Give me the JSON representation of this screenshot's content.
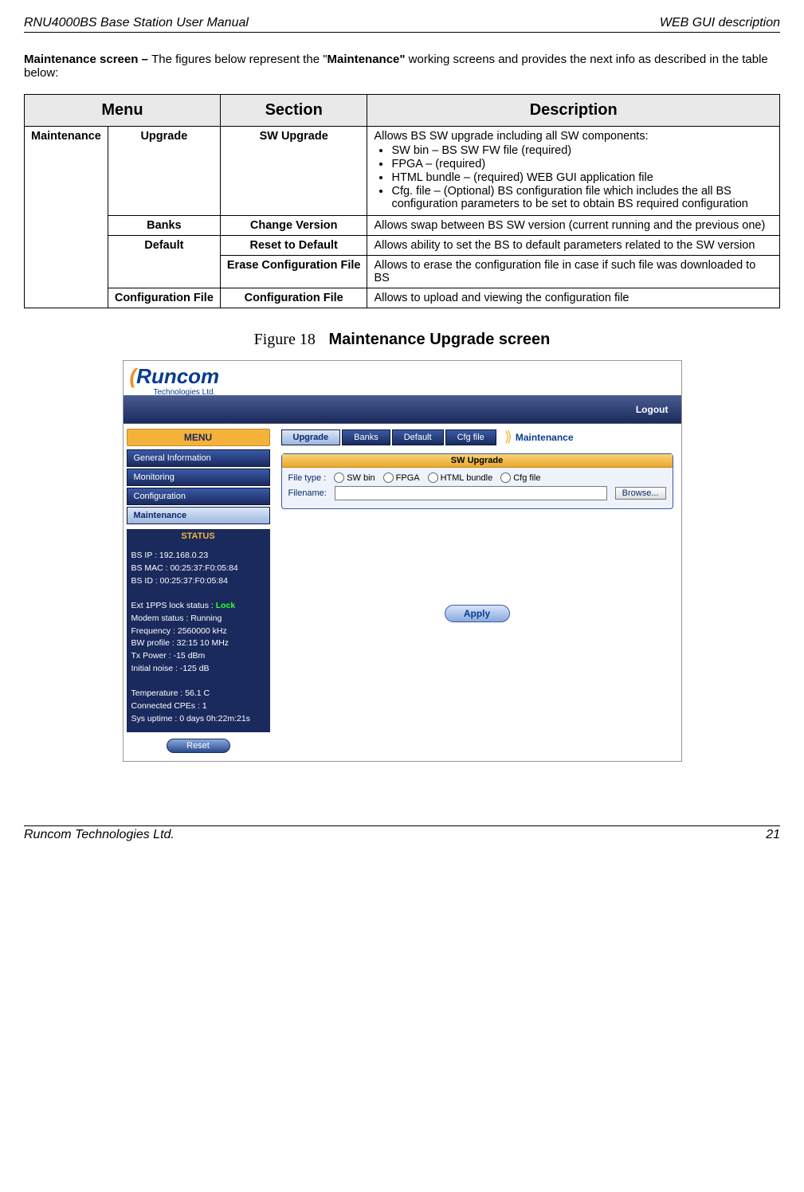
{
  "header": {
    "left": "RNU4000BS Base Station User Manual",
    "right": "WEB GUI description"
  },
  "intro": {
    "prefix_bold": "Maintenance screen – ",
    "mid1": "The figures below represent the \"",
    "bold2": "Maintenance\"",
    "mid2": " working screens and provides the next info as described in the table below:"
  },
  "table": {
    "headers": {
      "menu": "Menu",
      "section": "Section",
      "description": "Description"
    },
    "menu_label": "Maintenance",
    "rows": [
      {
        "sub": "Upgrade",
        "section": "SW Upgrade",
        "desc_lead": "Allows BS SW upgrade including all SW components:",
        "bullets": [
          "SW bin – BS SW FW file (required)",
          "FPGA – (required)",
          "HTML bundle – (required) WEB GUI application file",
          "Cfg. file – (Optional) BS configuration file which includes the all BS configuration parameters to be set to obtain BS required configuration"
        ]
      },
      {
        "sub": "Banks",
        "section": "Change Version",
        "desc": "Allows swap between BS SW version (current running and the previous one)"
      },
      {
        "sub": "Default",
        "section": "Reset to Default",
        "desc": "Allows ability to set the BS to default parameters related to the SW version"
      },
      {
        "sub": "",
        "section": "Erase Configuration File",
        "desc": "Allows to erase the configuration file in case if such file was downloaded to BS"
      },
      {
        "sub": "Configuration File",
        "section": "Configuration File",
        "desc": "Allows to upload and viewing the configuration file"
      }
    ]
  },
  "figure": {
    "num": "Figure 18",
    "title": "Maintenance Upgrade screen"
  },
  "screenshot": {
    "logo": {
      "brand_prefix": "R",
      "brand_rest": "uncom",
      "subtitle": "Technologies Ltd."
    },
    "logout": "Logout",
    "sidebar": {
      "menu_title": "MENU",
      "items": [
        "General Information",
        "Monitoring",
        "Configuration",
        "Maintenance"
      ],
      "active_index": 3,
      "status_title": "STATUS",
      "status_lines_1": [
        "BS IP :  192.168.0.23",
        "BS MAC :  00:25:37:F0:05:84",
        "BS ID :  00:25:37:F0:05:84"
      ],
      "status_lock_label": "Ext 1PPS lock status :  ",
      "status_lock_value": "Lock",
      "status_lines_2": [
        "Modem status :  Running",
        "Frequency :  2560000 kHz",
        "BW profile :  32:15 10 MHz",
        "Tx Power :  -15 dBm",
        "Initial noise :  -125 dB"
      ],
      "status_lines_3": [
        "Temperature :  56.1 C",
        "Connected CPEs :  1",
        "Sys uptime :  0 days 0h:22m:21s"
      ],
      "reset": "Reset"
    },
    "tabs": {
      "items": [
        "Upgrade",
        "Banks",
        "Default",
        "Cfg file"
      ],
      "active_index": 0,
      "section_label": "Maintenance"
    },
    "panel": {
      "title": "SW Upgrade",
      "filetype_label": "File type :",
      "radios": [
        "SW bin",
        "FPGA",
        "HTML bundle",
        "Cfg file"
      ],
      "filename_label": "Filename:",
      "browse": "Browse...",
      "apply": "Apply"
    }
  },
  "footer": {
    "left": "Runcom Technologies Ltd.",
    "right": "21"
  }
}
